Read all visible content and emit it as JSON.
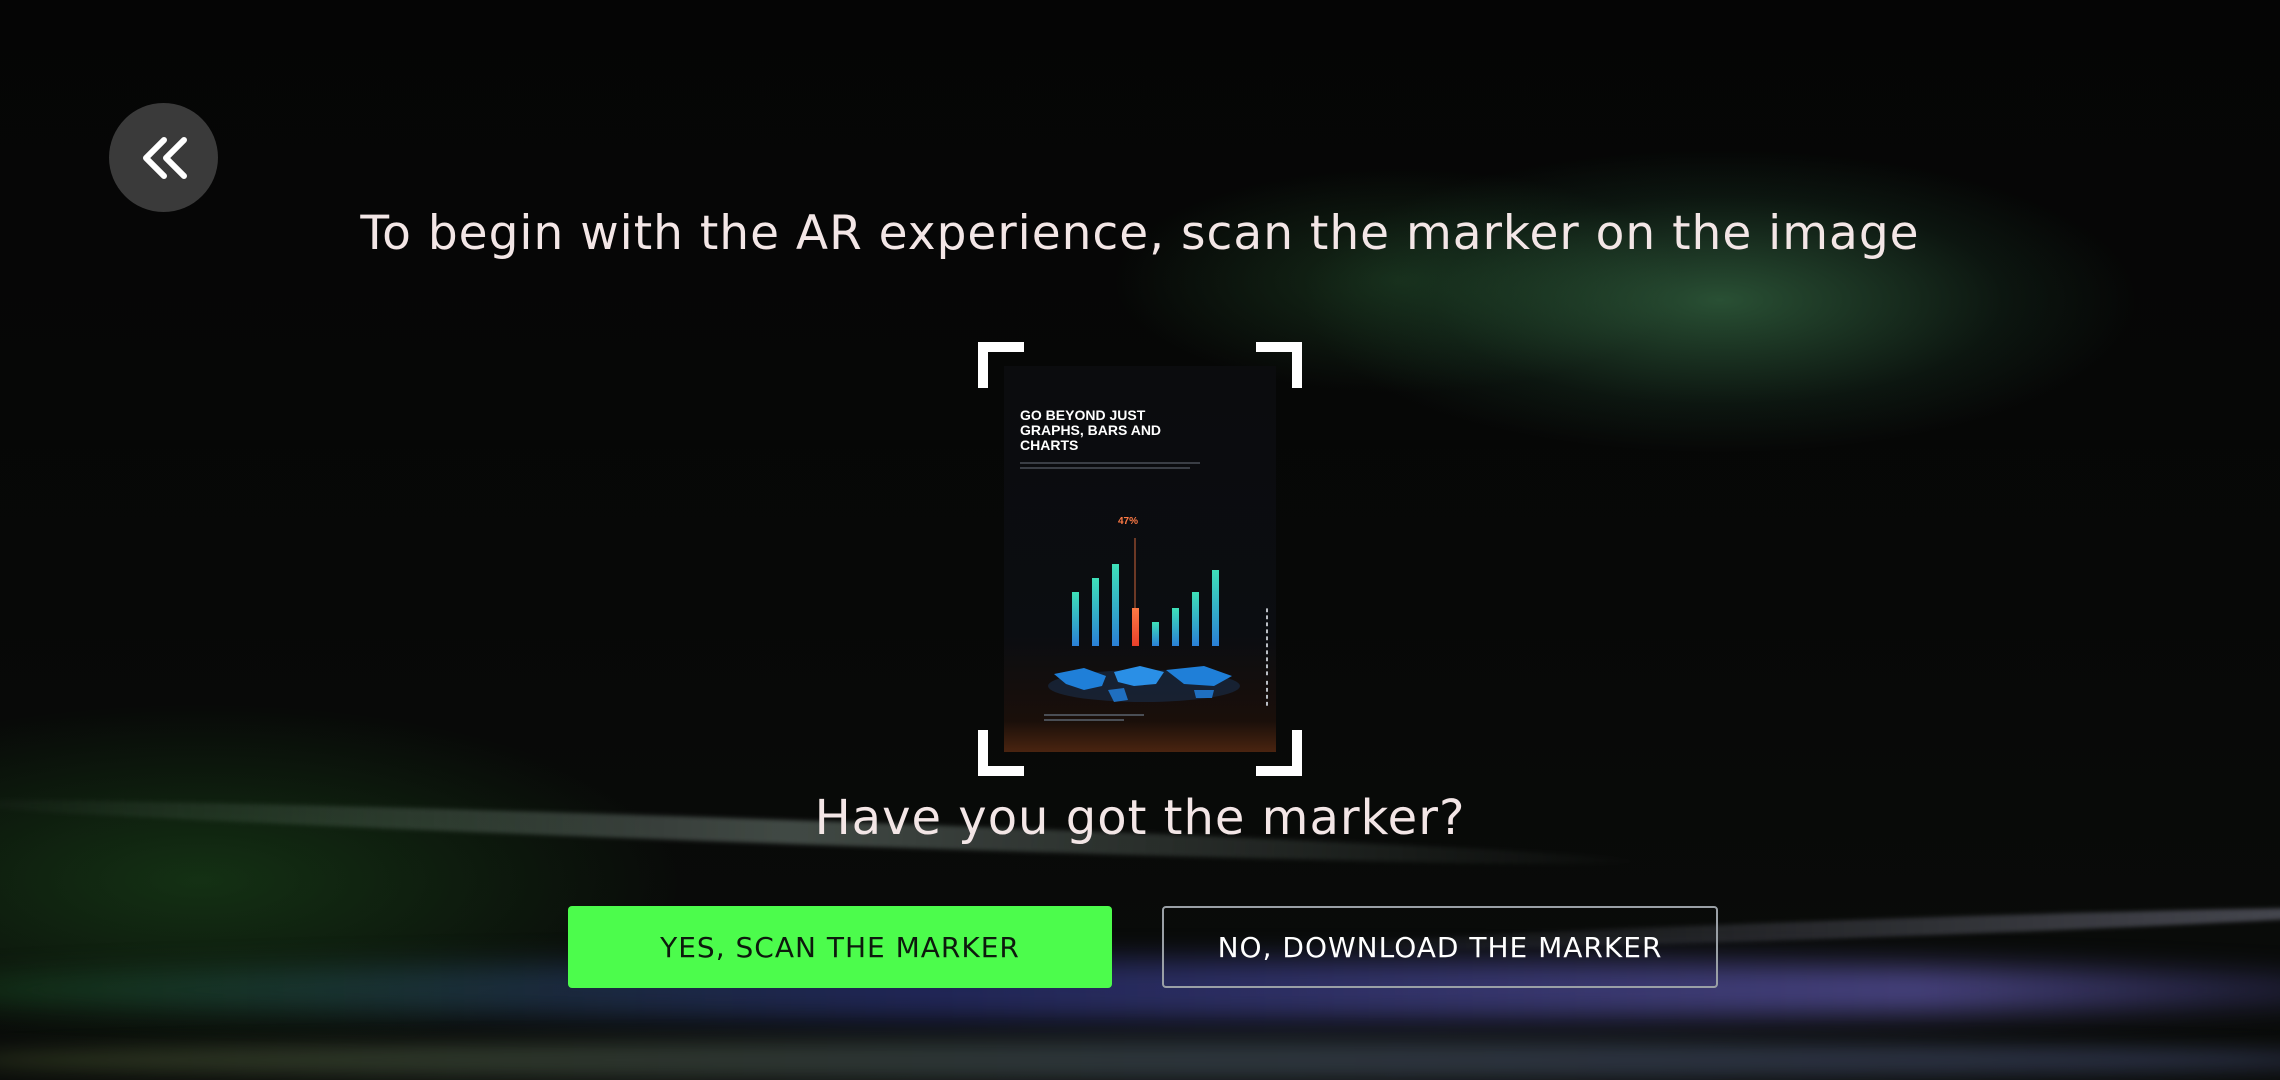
{
  "header": {
    "back_icon": "double-chevron-left-icon",
    "headline": "To begin with the AR experience, scan the marker on the image"
  },
  "marker": {
    "poster_title": "GO BEYOND JUST\nGRAPHS, BARS AND\nCHARTS",
    "poster_percent": "47%",
    "bar_highlight_color": "#ff5a3a",
    "bar_color": "#34d3c8"
  },
  "prompt": {
    "question": "Have you got the marker?"
  },
  "actions": {
    "yes_label": "YES, SCAN THE MARKER",
    "no_label": "NO, DOWNLOAD THE MARKER"
  },
  "colors": {
    "accent_green": "#4cfc4c",
    "text": "#f3e6e6",
    "back_button_bg": "#3a3a3a"
  }
}
